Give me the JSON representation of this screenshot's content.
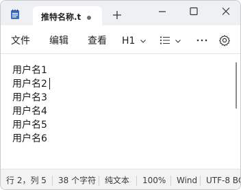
{
  "tab": {
    "title": "推特名称.t",
    "unsaved_indicator": true
  },
  "menu": {
    "file": "文件",
    "edit": "编辑",
    "view": "查看",
    "heading": "H1"
  },
  "icons": {
    "app": "notepad-icon",
    "new_tab": "plus-icon",
    "list": "bullet-list-icon",
    "more": "more-icon",
    "settings": "gear-icon",
    "minimize": "minimize-icon",
    "maximize": "maximize-icon",
    "close": "close-icon"
  },
  "editor": {
    "lines": [
      "用户名1",
      "用户名2",
      "用户名3",
      "用户名4",
      "用户名5",
      "用户名6"
    ],
    "caret_line": 2
  },
  "status": {
    "position": "行 2，列 5",
    "char_count": "38 个字符",
    "format": "纯文本",
    "zoom": "100%",
    "line_ending": "Wind",
    "encoding": "UTF-8 BO"
  },
  "colors": {
    "titlebar_bg": "#eef0f4",
    "statusbar_bg": "#f3f3f3",
    "icon_blue": "#3a6fc4"
  }
}
